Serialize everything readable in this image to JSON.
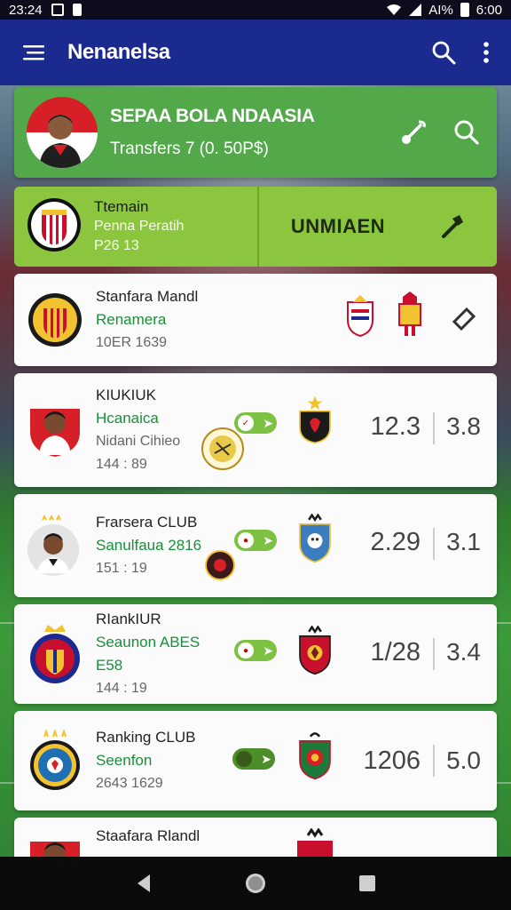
{
  "status_bar": {
    "time": "23:24",
    "battery": "AI%",
    "clock_right": "6:00"
  },
  "app_bar": {
    "title": "Nenanelsa"
  },
  "banner": {
    "title": "SEPAA BOLA NDAASIA",
    "subtitle": "Transfers 7 (0. 50P$)"
  },
  "team_card": {
    "title": "Ttemain",
    "subtitle": "Penna Peratih",
    "code": "P26 13",
    "action_label": "UNMIAEN"
  },
  "matches": [
    {
      "name": "Stanfara Mandl",
      "subtitle": "Renamera",
      "meta": "10ER 1639"
    },
    {
      "name": "KIUKIUK",
      "subtitle": "Hcanaica",
      "extra": "Nidani Cihieo",
      "meta": "144 : 89",
      "score1": "12.3",
      "score2": "3.8"
    },
    {
      "name": "Frarsera CLUB",
      "subtitle": "Sanulfaua 2816",
      "meta": "151 : 19",
      "score1": "2.29",
      "score2": "3.1"
    },
    {
      "name": "RIankIUR",
      "subtitle": "Seaunon ABES E58",
      "meta": "144 : 19",
      "score1": "1/28",
      "score2": "3.4"
    },
    {
      "name": "Ranking CLUB",
      "subtitle": "Seenfon",
      "meta": "2643 1629",
      "score1": "1206",
      "score2": "5.0"
    },
    {
      "name": "Staafara Rlandl"
    }
  ],
  "colors": {
    "app_bar": "#1a2a8e",
    "banner": "#53a94a",
    "team_card": "#8cc63f",
    "accent_green": "#1a8f3a",
    "pill": "#7dc142"
  },
  "icons": {
    "menu": "menu-icon",
    "search": "search-icon",
    "more": "more-vert-icon",
    "transfer": "transfer-icon",
    "filter": "search-icon",
    "hammer": "hammer-icon",
    "back": "back-icon",
    "home": "home-icon",
    "recents": "recents-icon"
  }
}
